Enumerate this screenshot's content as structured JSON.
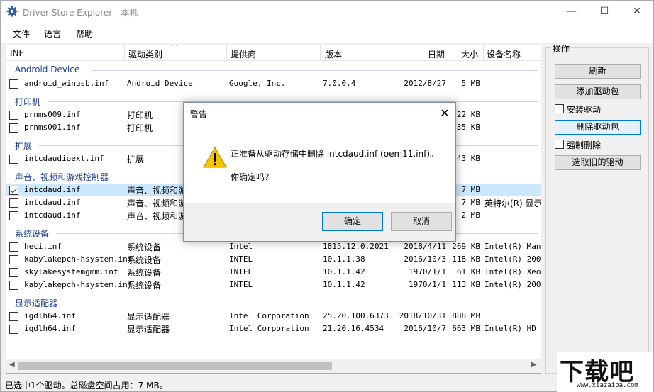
{
  "window": {
    "title": "Driver Store Explorer - 本机",
    "controls": {
      "minimize": "—",
      "maximize": "☐",
      "close": "✕"
    }
  },
  "menu": [
    "文件",
    "语言",
    "帮助"
  ],
  "columns": [
    "INF",
    "驱动类别",
    "提供商",
    "版本",
    "日期",
    "大小",
    "设备名称"
  ],
  "groups": [
    {
      "label": "Android Device",
      "rows": [
        {
          "checked": false,
          "selected": false,
          "inf": "android_winusb.inf",
          "category": "Android Device",
          "provider": "Google, Inc.",
          "version": "7.0.0.4",
          "date": "2012/8/27",
          "size": "5 MB",
          "device": ""
        }
      ]
    },
    {
      "label": "打印机",
      "rows": [
        {
          "checked": false,
          "selected": false,
          "inf": "prnms009.inf",
          "category": "打印机",
          "provider": "",
          "version": "",
          "date": "",
          "size": "22 KB",
          "device": ""
        },
        {
          "checked": false,
          "selected": false,
          "inf": "prnms001.inf",
          "category": "打印机",
          "provider": "",
          "version": "",
          "date": "",
          "size": "35 KB",
          "device": ""
        }
      ]
    },
    {
      "label": "扩展",
      "rows": [
        {
          "checked": false,
          "selected": false,
          "inf": "intcdaudioext.inf",
          "category": "扩展",
          "provider": "",
          "version": "",
          "date": "",
          "size": "43 KB",
          "device": ""
        }
      ]
    },
    {
      "label": "声音、视频和游戏控制器",
      "rows": [
        {
          "checked": true,
          "selected": true,
          "inf": "intcdaud.inf",
          "category": "声音、视频和游",
          "provider": "",
          "version": "",
          "date": "",
          "size": "7 MB",
          "device": ""
        },
        {
          "checked": false,
          "selected": false,
          "inf": "intcdaud.inf",
          "category": "声音、视频和游",
          "provider": "",
          "version": "",
          "date": "",
          "size": "7 MB",
          "device": "英特尔(R) 显示"
        },
        {
          "checked": false,
          "selected": false,
          "inf": "intcdaud.inf",
          "category": "声音、视频和游",
          "provider": "",
          "version": "",
          "date": "",
          "size": "2 MB",
          "device": ""
        }
      ]
    },
    {
      "label": "系统设备",
      "rows": [
        {
          "checked": false,
          "selected": false,
          "inf": "heci.inf",
          "category": "系统设备",
          "provider": "Intel",
          "version": "1815.12.0.2021",
          "date": "2018/4/11",
          "size": "269 KB",
          "device": "Intel(R) Mana"
        },
        {
          "checked": false,
          "selected": false,
          "inf": "kabylakepch-hsystem.inf",
          "category": "系统设备",
          "provider": "INTEL",
          "version": "10.1.1.38",
          "date": "2016/10/3",
          "size": "118 KB",
          "device": "Intel(R) 200"
        },
        {
          "checked": false,
          "selected": false,
          "inf": "skylakesystemgmm.inf",
          "category": "系统设备",
          "provider": "INTEL",
          "version": "10.1.1.42",
          "date": "1970/1/1",
          "size": "61 KB",
          "device": "Intel(R) Xeon"
        },
        {
          "checked": false,
          "selected": false,
          "inf": "kabylakepch-hsystem.inf",
          "category": "系统设备",
          "provider": "INTEL",
          "version": "10.1.1.42",
          "date": "1970/1/1",
          "size": "113 KB",
          "device": "Intel(R) 200"
        }
      ]
    },
    {
      "label": "显示适配器",
      "rows": [
        {
          "checked": false,
          "selected": false,
          "inf": "igdlh64.inf",
          "category": "显示适配器",
          "provider": "Intel Corporation",
          "version": "25.20.100.6373",
          "date": "2018/10/31",
          "size": "888 MB",
          "device": ""
        },
        {
          "checked": false,
          "selected": false,
          "inf": "igdlh64.inf",
          "category": "显示适配器",
          "provider": "Intel Corporation",
          "version": "21.20.16.4534",
          "date": "2016/10/7",
          "size": "663 MB",
          "device": "Intel(R) HD G"
        }
      ]
    }
  ],
  "side": {
    "legend": "操作",
    "refresh": "刷新",
    "add": "添加驱动包",
    "install": "安装驱动",
    "delete": "删除驱动包",
    "force": "强制删除",
    "select_old": "选取旧的驱动"
  },
  "status": "已选中1个驱动。总磁盘空间占用：7 MB。",
  "watermark": {
    "logo": "下载吧",
    "url": "www.xiazaiba.com"
  },
  "dialog": {
    "title": "警告",
    "message": "正准备从驱动存储中删除 intcdaud.inf (oem11.inf)。",
    "question": "你确定吗？",
    "ok": "确定",
    "cancel": "取消"
  },
  "colors": {
    "selection": "#cce8ff",
    "group_text": "#1e3f8c",
    "accent": "#0078d7",
    "warning": "#f5c400"
  }
}
